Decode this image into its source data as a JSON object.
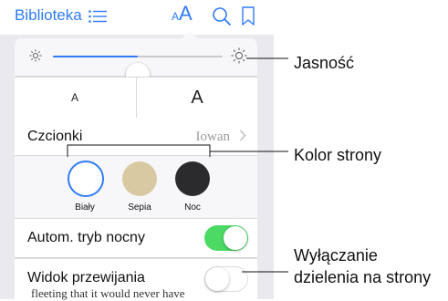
{
  "toolbar": {
    "library_label": "Biblioteka",
    "aa_small": "A",
    "aa_big": "A",
    "icons": [
      "list-icon",
      "search-icon",
      "bookmark-icon"
    ]
  },
  "settings": {
    "brightness": {
      "level": 0.5
    },
    "font_size": {
      "small_label": "A",
      "large_label": "A"
    },
    "font": {
      "label": "Czcionki",
      "value": "Iowan"
    },
    "themes": [
      {
        "label": "Biały",
        "color": "#ffffff",
        "selected": true
      },
      {
        "label": "Sepia",
        "color": "#d9c9a3",
        "selected": false
      },
      {
        "label": "Noc",
        "color": "#2b2b2d",
        "selected": false
      }
    ],
    "auto_night": {
      "label": "Autom. tryb nocny",
      "on": true
    },
    "scroll_view": {
      "label": "Widok przewijania",
      "on": false
    }
  },
  "book_text": "fleeting that it would never have",
  "callouts": {
    "brightness": "Jasność",
    "page_color": "Kolor strony",
    "scroll_line1": "Wyłączanie",
    "scroll_line2": "dzielenia na strony"
  },
  "colors": {
    "accent": "#2f7cf6",
    "toggle_on": "#4cd964"
  }
}
